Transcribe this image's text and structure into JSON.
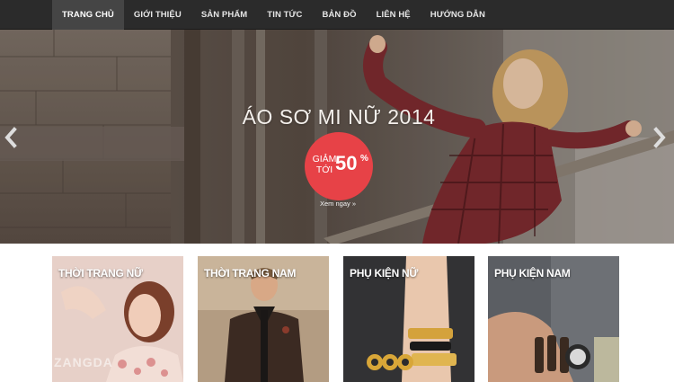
{
  "nav": {
    "items": [
      {
        "label": "TRANG CHỦ",
        "active": true
      },
      {
        "label": "GIỚI THIỆU",
        "active": false
      },
      {
        "label": "SẢN PHẨM",
        "active": false
      },
      {
        "label": "TIN TỨC",
        "active": false
      },
      {
        "label": "BẢN ĐỒ",
        "active": false
      },
      {
        "label": "LIÊN HỆ",
        "active": false
      },
      {
        "label": "HƯỚNG DẪN",
        "active": false
      }
    ]
  },
  "hero": {
    "title": "ÁO SƠ MI NỮ 2014",
    "badge": {
      "label": "GIẢM TỚI",
      "number": "50",
      "suffix": "%"
    },
    "link": "Xem ngay »",
    "icons": {
      "prev": "chevron-left-icon",
      "next": "chevron-right-icon"
    }
  },
  "categories": [
    {
      "label": "THỜI TRANG NỮ"
    },
    {
      "label": "THỜI TRANG NAM"
    },
    {
      "label": "PHỤ KIỆN NỮ"
    },
    {
      "label": "PHỤ KIỆN NAM"
    }
  ],
  "watermark": "ZANGDA",
  "colors": {
    "nav_bg": "#2b2b2b",
    "nav_active": "#454545",
    "badge": "#e74247"
  }
}
